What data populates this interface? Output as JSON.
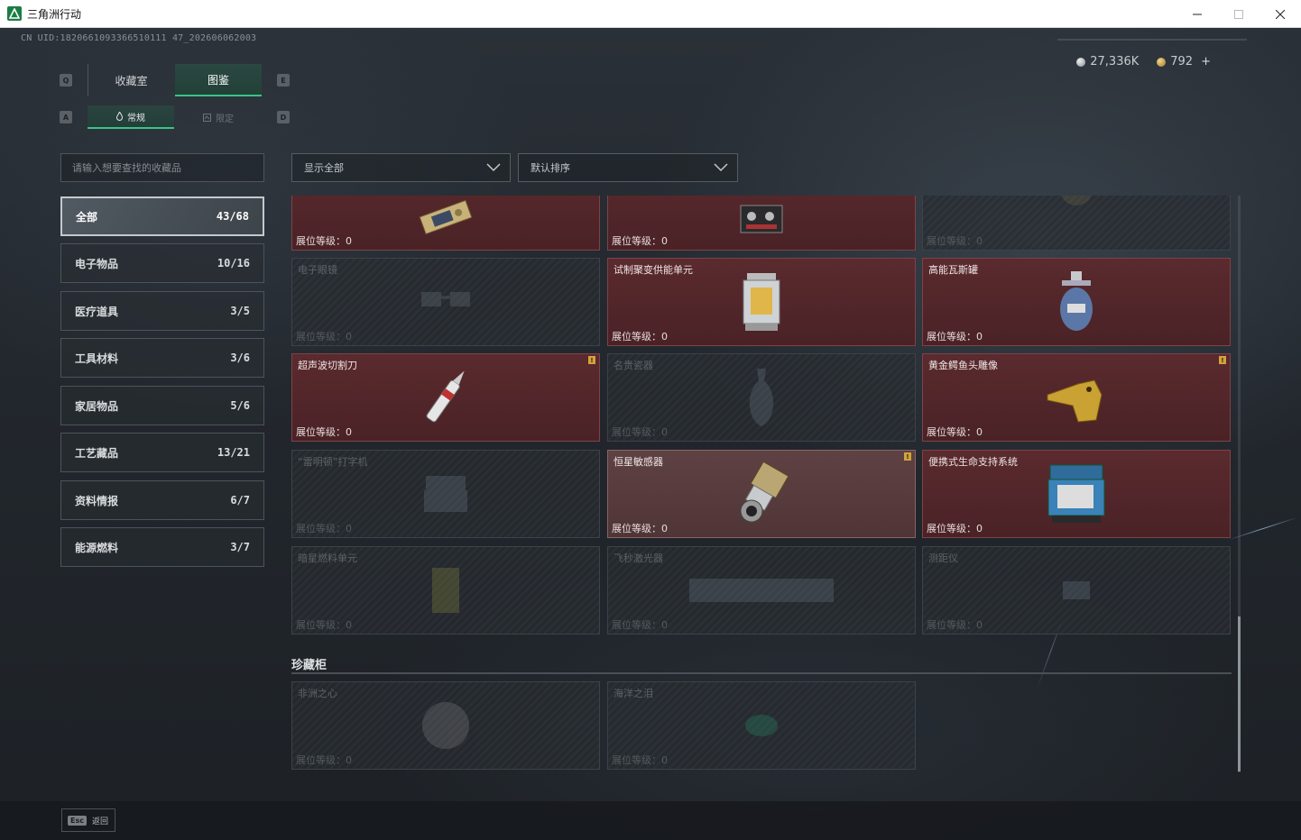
{
  "window": {
    "title": "三角洲行动",
    "buttons": [
      "minimize",
      "maximize",
      "close"
    ]
  },
  "header": {
    "uid": "CN UID:1820661093366510111 47_202606062003"
  },
  "currency": {
    "silver": "27,336K",
    "gold": "792",
    "plus": "+"
  },
  "tabs": {
    "main": [
      {
        "label": "收藏室",
        "active": false,
        "key_left": "Q"
      },
      {
        "label": "图鉴",
        "active": true,
        "key_right": "E"
      }
    ],
    "sub": [
      {
        "label": "常规",
        "active": true,
        "key_left": "A"
      },
      {
        "label": "限定",
        "active": false,
        "key_right": "D"
      }
    ]
  },
  "search": {
    "placeholder": "请输入想要查找的收藏品"
  },
  "categories": [
    {
      "label": "全部",
      "count": "43/68",
      "active": true
    },
    {
      "label": "电子物品",
      "count": "10/16"
    },
    {
      "label": "医疗道具",
      "count": "3/5"
    },
    {
      "label": "工具材料",
      "count": "3/6"
    },
    {
      "label": "家居物品",
      "count": "5/6"
    },
    {
      "label": "工艺藏品",
      "count": "13/21"
    },
    {
      "label": "资料情报",
      "count": "6/7"
    },
    {
      "label": "能源燃料",
      "count": "3/7"
    }
  ],
  "filters": {
    "show": "显示全部",
    "sort": "默认排序"
  },
  "level_label": "展位等级：0",
  "cards": [
    {
      "name": "",
      "owned": true,
      "icon": "circuit-board-icon"
    },
    {
      "name": "",
      "owned": true,
      "icon": "radio-device-icon"
    },
    {
      "name": "",
      "owned": false,
      "icon": "medal-icon"
    },
    {
      "name": "电子眼镜",
      "owned": false,
      "icon": "glasses-icon"
    },
    {
      "name": "试制聚变供能单元",
      "owned": true,
      "icon": "fusion-unit-icon"
    },
    {
      "name": "高能瓦斯罐",
      "owned": true,
      "icon": "gas-canister-icon"
    },
    {
      "name": "超声波切割刀",
      "owned": true,
      "badge": true,
      "icon": "ultrasonic-knife-icon"
    },
    {
      "name": "名贵瓷器",
      "owned": false,
      "icon": "vase-icon"
    },
    {
      "name": "黄金鳄鱼头雕像",
      "owned": true,
      "badge": true,
      "icon": "gold-croc-icon"
    },
    {
      "name": "“雷明顿”打字机",
      "owned": false,
      "icon": "typewriter-icon"
    },
    {
      "name": "恒星敏感器",
      "owned": true,
      "highlight": true,
      "badge": true,
      "icon": "star-sensor-icon"
    },
    {
      "name": "便携式生命支持系统",
      "owned": true,
      "icon": "life-support-icon"
    },
    {
      "name": "暗星燃料单元",
      "owned": false,
      "icon": "fuel-cell-icon"
    },
    {
      "name": "飞秒激光器",
      "owned": false,
      "icon": "laser-icon"
    },
    {
      "name": "测距仪",
      "owned": false,
      "icon": "rangefinder-icon"
    }
  ],
  "section": {
    "title": "珍藏柜"
  },
  "cabinet": [
    {
      "name": "非洲之心",
      "owned": false,
      "icon": "diamond-icon"
    },
    {
      "name": "海洋之泪",
      "owned": false,
      "icon": "gem-icon"
    }
  ],
  "footer": {
    "esc_key": "Esc",
    "esc_label": "返回"
  },
  "colors": {
    "accent": "#3ac388",
    "owned_card": "#4e2428",
    "badge": "#d4a33a"
  }
}
